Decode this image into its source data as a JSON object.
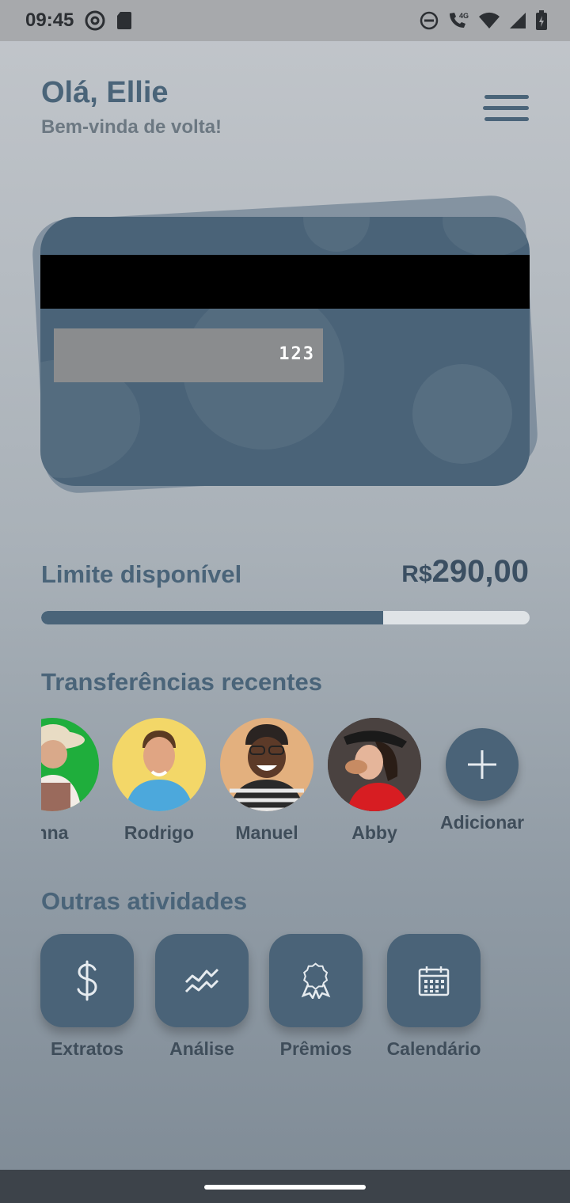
{
  "status": {
    "time": "09:45",
    "network": "4G"
  },
  "header": {
    "greeting": "Olá, Ellie",
    "subtitle": "Bem-vinda de volta!"
  },
  "card": {
    "cvv": "123"
  },
  "limit": {
    "label": "Limite disponível",
    "currency": "R$",
    "amount": "290,00",
    "progress_fraction": 0.7
  },
  "transfers": {
    "title": "Transferências recentes",
    "contacts": [
      {
        "name": "nna"
      },
      {
        "name": "Rodrigo"
      },
      {
        "name": "Manuel"
      },
      {
        "name": "Abby"
      }
    ],
    "add_label": "Adicionar"
  },
  "activities": {
    "title": "Outras atividades",
    "items": [
      {
        "label": "Extratos",
        "icon": "dollar-icon"
      },
      {
        "label": "Análise",
        "icon": "chart-icon"
      },
      {
        "label": "Prêmios",
        "icon": "award-icon"
      },
      {
        "label": "Calendário",
        "icon": "calendar-icon"
      }
    ]
  },
  "colors": {
    "primary": "#4a6378",
    "text": "#4a6479"
  }
}
